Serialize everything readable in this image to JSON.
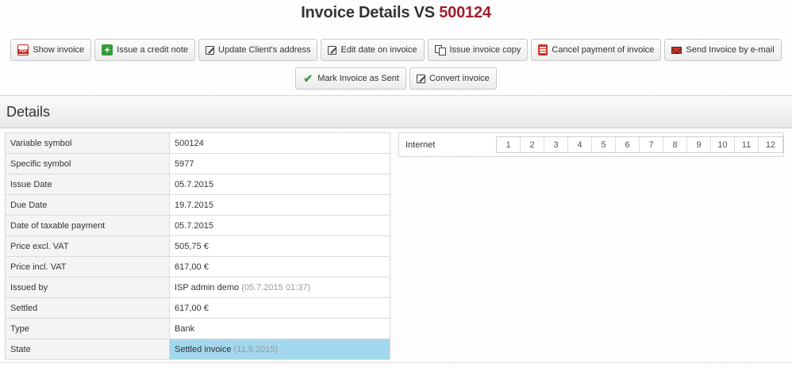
{
  "header": {
    "title_prefix": "Invoice Details VS",
    "title_number": "500124"
  },
  "toolbar": {
    "buttons": [
      {
        "label": "Show invoice",
        "icon": "pdf-icon"
      },
      {
        "label": "Issue a credit note",
        "icon": "plus-icon"
      },
      {
        "label": "Update Client's address",
        "icon": "edit-icon"
      },
      {
        "label": "Edit date on invoice",
        "icon": "edit-icon"
      },
      {
        "label": "Issue invoice copy",
        "icon": "copy-icon"
      },
      {
        "label": "Cancel payment of invoice",
        "icon": "cancel-icon"
      },
      {
        "label": "Send Invoice by e-mail",
        "icon": "mail-icon"
      },
      {
        "label": "Mark Invoice as Sent",
        "icon": "check-icon"
      },
      {
        "label": "Convert invoice",
        "icon": "edit-icon"
      }
    ]
  },
  "section": {
    "title": "Details"
  },
  "details": {
    "rows": [
      {
        "label": "Variable symbol",
        "value": "500124"
      },
      {
        "label": "Specific symbol",
        "value": "5977"
      },
      {
        "label": "Issue Date",
        "value": "05.7.2015"
      },
      {
        "label": "Due Date",
        "value": "19.7.2015"
      },
      {
        "label": "Date of taxable payment",
        "value": "05.7.2015"
      },
      {
        "label": "Price excl. VAT",
        "value": "505,75 €"
      },
      {
        "label": "Price incl. VAT",
        "value": "617,00 €"
      },
      {
        "label": "Issued by",
        "value": "ISP admin demo",
        "note": "(05.7.2015 01:37)"
      },
      {
        "label": "Settled",
        "value": "617,00 €"
      },
      {
        "label": "Type",
        "value": "Bank"
      },
      {
        "label": "State",
        "value": "Settled invoice",
        "note": "(11.9.2015)"
      }
    ]
  },
  "services": {
    "label": "Internet",
    "months": [
      "1",
      "2",
      "3",
      "4",
      "5",
      "6",
      "7",
      "8",
      "9",
      "10",
      "11",
      "12"
    ]
  },
  "colors": {
    "title_accent": "#a21d2d",
    "state_highlight": "#a3d7ed"
  }
}
